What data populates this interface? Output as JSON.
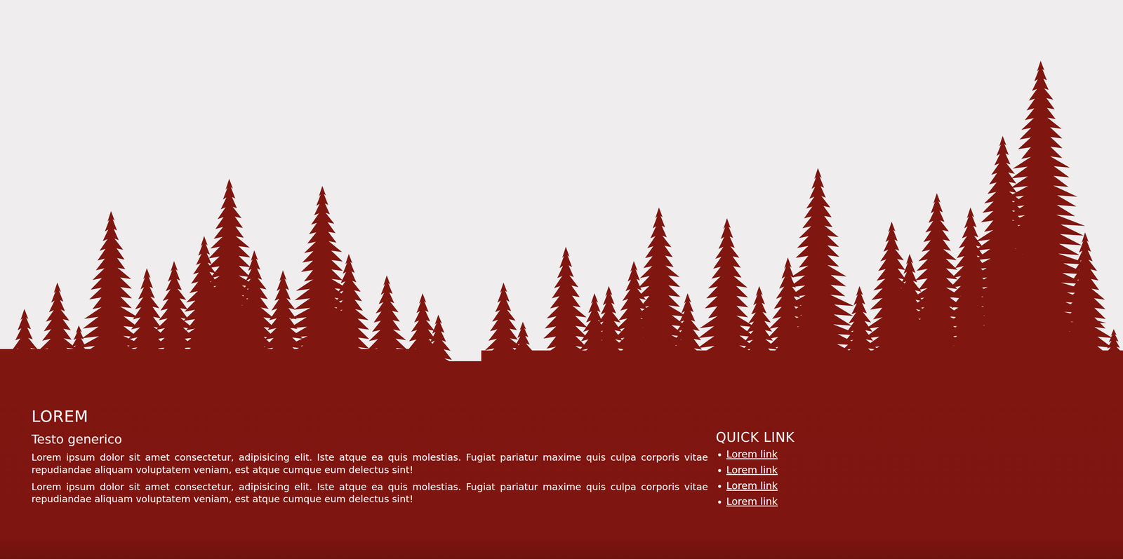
{
  "footer": {
    "title": "LOREM",
    "subtitle": "Testo generico",
    "paragraphs": [
      "Lorem ipsum dolor sit amet consectetur, adipisicing elit. Iste atque ea quis molestias. Fugiat pariatur maxime quis culpa corporis vitae repudiandae aliquam voluptatem veniam, est atque cumque eum delectus sint!",
      "Lorem ipsum dolor sit amet consectetur, adipisicing elit. Iste atque ea quis molestias. Fugiat pariatur maxime quis culpa corporis vitae repudiandae aliquam voluptatem veniam, est atque cumque eum delectus sint!"
    ],
    "quick_links": {
      "title": "QUICK LINK",
      "items": [
        "Lorem link",
        "Lorem link",
        "Lorem link",
        "Lorem link"
      ]
    }
  }
}
